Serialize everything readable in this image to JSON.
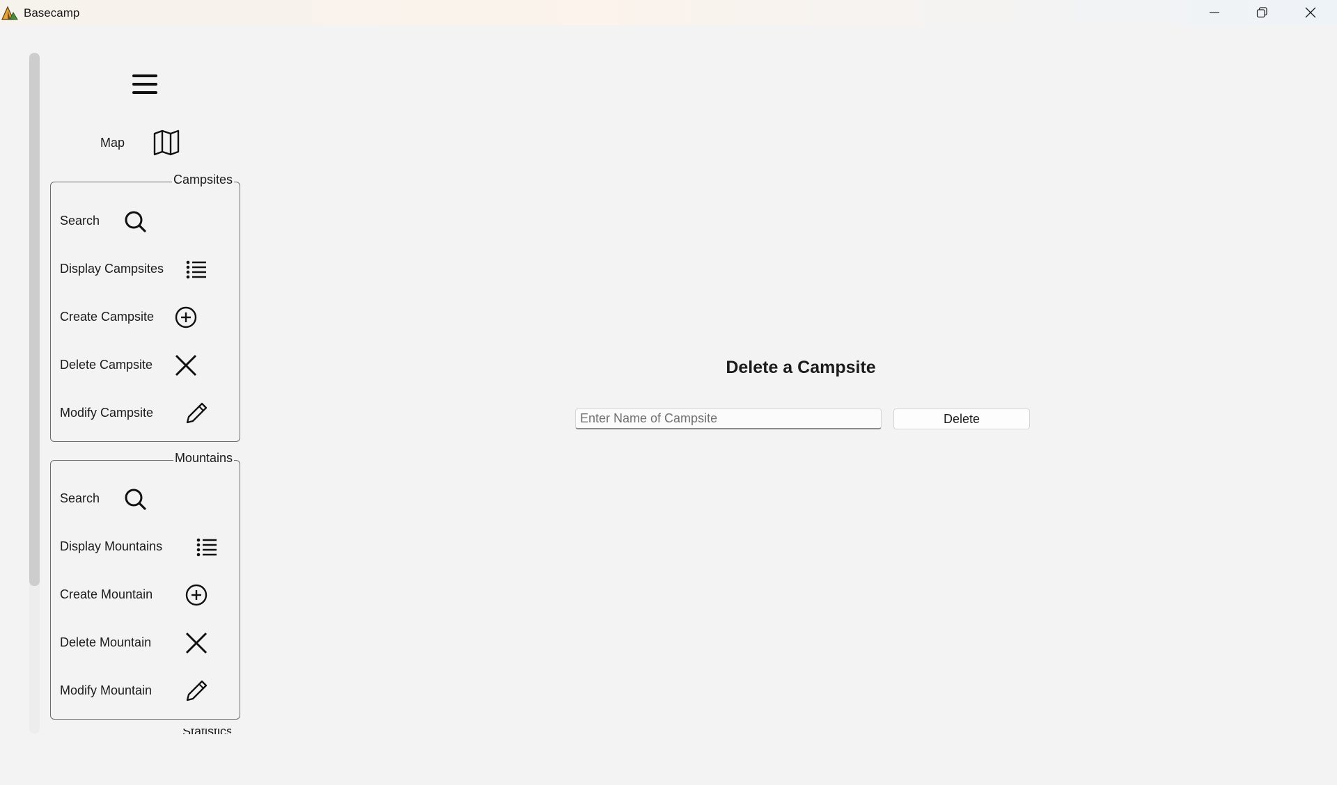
{
  "window": {
    "title": "Basecamp",
    "controls": [
      "minimize",
      "maximize",
      "close"
    ]
  },
  "sidebar": {
    "menu_icon": "hamburger-icon",
    "map": {
      "label": "Map",
      "icon": "map-icon"
    },
    "groups": [
      {
        "title": "Campsites",
        "items": [
          {
            "label": "Search",
            "icon": "search-icon"
          },
          {
            "label": "Display Campsites",
            "icon": "list-icon"
          },
          {
            "label": "Create Campsite",
            "icon": "plus-circle-icon"
          },
          {
            "label": "Delete Campsite",
            "icon": "close-icon"
          },
          {
            "label": "Modify Campsite",
            "icon": "pencil-icon"
          }
        ]
      },
      {
        "title": "Mountains",
        "items": [
          {
            "label": "Search",
            "icon": "search-icon"
          },
          {
            "label": "Display Mountains",
            "icon": "list-icon"
          },
          {
            "label": "Create Mountain",
            "icon": "plus-circle-icon"
          },
          {
            "label": "Delete Mountain",
            "icon": "close-icon"
          },
          {
            "label": "Modify Mountain",
            "icon": "pencil-icon"
          }
        ]
      }
    ],
    "partial_group_title": "Statistics"
  },
  "main": {
    "title": "Delete a Campsite",
    "name_input": {
      "placeholder": "Enter Name of Campsite",
      "value": ""
    },
    "delete_label": "Delete"
  }
}
